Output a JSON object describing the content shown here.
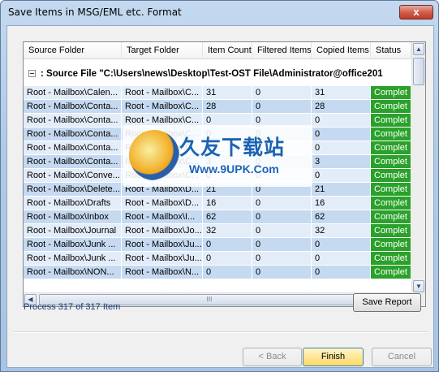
{
  "window": {
    "title": "Save Items in MSG/EML etc. Format",
    "close_glyph": "x"
  },
  "grid": {
    "columns": [
      "Source Folder",
      "Target Folder",
      "Item Count",
      "Filtered Items",
      "Copied Items",
      "Status"
    ],
    "group_label": ": Source File  \"C:\\Users\\news\\Desktop\\Test-OST File\\Administrator@office201",
    "rows": [
      [
        "Root - Mailbox\\Calen...",
        "Root - Mailbox\\C...",
        "31",
        "0",
        "31",
        "Complet"
      ],
      [
        "Root - Mailbox\\Conta...",
        "Root - Mailbox\\C...",
        "28",
        "0",
        "28",
        "Complet"
      ],
      [
        "Root - Mailbox\\Conta...",
        "Root - Mailbox\\C...",
        "0",
        "0",
        "0",
        "Complet"
      ],
      [
        "Root - Mailbox\\Conta...",
        "Root - Mailbox\\C...",
        "0",
        "0",
        "0",
        "Complet"
      ],
      [
        "Root - Mailbox\\Conta...",
        "Root - Mailbox\\C...",
        "0",
        "0",
        "0",
        "Complet"
      ],
      [
        "Root - Mailbox\\Conta...",
        "Root - Mailbox\\C...",
        "3",
        "0",
        "3",
        "Complet"
      ],
      [
        "Root - Mailbox\\Conve...",
        "Root - Mailbox\\C...",
        "0",
        "0",
        "0",
        "Complet"
      ],
      [
        "Root - Mailbox\\Delete...",
        "Root - Mailbox\\D...",
        "21",
        "0",
        "21",
        "Complet"
      ],
      [
        "Root - Mailbox\\Drafts",
        "Root - Mailbox\\D...",
        "16",
        "0",
        "16",
        "Complet"
      ],
      [
        "Root - Mailbox\\Inbox",
        "Root - Mailbox\\I...",
        "62",
        "0",
        "62",
        "Complet"
      ],
      [
        "Root - Mailbox\\Journal",
        "Root - Mailbox\\Jo...",
        "32",
        "0",
        "32",
        "Complet"
      ],
      [
        "Root - Mailbox\\Junk ...",
        "Root - Mailbox\\Ju...",
        "0",
        "0",
        "0",
        "Complet"
      ],
      [
        "Root - Mailbox\\Junk ...",
        "Root - Mailbox\\Ju...",
        "0",
        "0",
        "0",
        "Complet"
      ],
      [
        "Root - Mailbox\\NON...",
        "Root - Mailbox\\N...",
        "0",
        "0",
        "0",
        "Complet"
      ]
    ],
    "status_color": "#2aa12a",
    "scroll_up": "▲",
    "scroll_down": "▼",
    "scroll_left": "◀",
    "scroll_right": "▶",
    "thumb_grip": "III"
  },
  "progress_text": "Process 317 of 317 Item",
  "buttons": {
    "save_report": "Save Report",
    "back": "< Back",
    "finish": "Finish",
    "cancel": "Cancel"
  },
  "watermark": {
    "title": "久友下载站",
    "url": "Www.9UPK.Com",
    "side_text": "WWW.9UPK.COM"
  }
}
